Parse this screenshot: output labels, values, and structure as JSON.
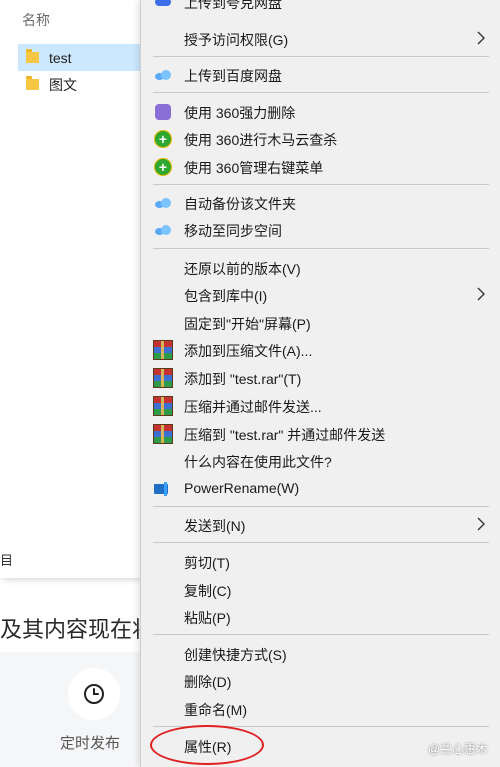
{
  "explorer": {
    "column_header": "名称",
    "files": [
      {
        "name": "test",
        "selected": true
      },
      {
        "name": "图文",
        "selected": false
      }
    ],
    "edge_glyph": "目"
  },
  "page_behind": {
    "text": "及其内容现在将",
    "schedule_label": "定时发布",
    "schedule_icon": "clock-icon"
  },
  "menu": {
    "top_partial_label": "上传到夸克网盘",
    "items": [
      {
        "label": "授予访问权限(G)",
        "icon": "",
        "submenu": true
      },
      {
        "label": "上传到百度网盘",
        "icon": "baidu-cloud-icon"
      },
      {
        "label": "使用 360强力删除",
        "icon": "shredder-icon"
      },
      {
        "label": "使用 360进行木马云查杀",
        "icon": "plus-circle-icon"
      },
      {
        "label": "使用 360管理右键菜单",
        "icon": "plus-circle-icon"
      },
      {
        "label": "自动备份该文件夹",
        "icon": "baidu-cloud-icon"
      },
      {
        "label": "移动至同步空间",
        "icon": "baidu-cloud-icon"
      },
      {
        "label": "还原以前的版本(V)",
        "icon": ""
      },
      {
        "label": "包含到库中(I)",
        "icon": "",
        "submenu": true
      },
      {
        "label": "固定到\"开始\"屏幕(P)",
        "icon": ""
      },
      {
        "label": "添加到压缩文件(A)...",
        "icon": "winrar-icon"
      },
      {
        "label": "添加到 \"test.rar\"(T)",
        "icon": "winrar-icon"
      },
      {
        "label": "压缩并通过邮件发送...",
        "icon": "winrar-icon"
      },
      {
        "label": "压缩到 \"test.rar\" 并通过邮件发送",
        "icon": "winrar-icon"
      },
      {
        "label": "什么内容在使用此文件?",
        "icon": ""
      },
      {
        "label": "PowerRename(W)",
        "icon": "powerrename-icon"
      },
      {
        "label": "发送到(N)",
        "icon": "",
        "submenu": true
      },
      {
        "label": "剪切(T)",
        "icon": ""
      },
      {
        "label": "复制(C)",
        "icon": ""
      },
      {
        "label": "粘贴(P)",
        "icon": ""
      },
      {
        "label": "创建快捷方式(S)",
        "icon": ""
      },
      {
        "label": "删除(D)",
        "icon": ""
      },
      {
        "label": "重命名(M)",
        "icon": ""
      },
      {
        "label": "属性(R)",
        "icon": ""
      }
    ]
  },
  "watermark": "@兰心惠木",
  "colors": {
    "selection": "#cce8ff",
    "menu_bg": "#f0f0f0",
    "highlight_circle": "#e02020"
  }
}
